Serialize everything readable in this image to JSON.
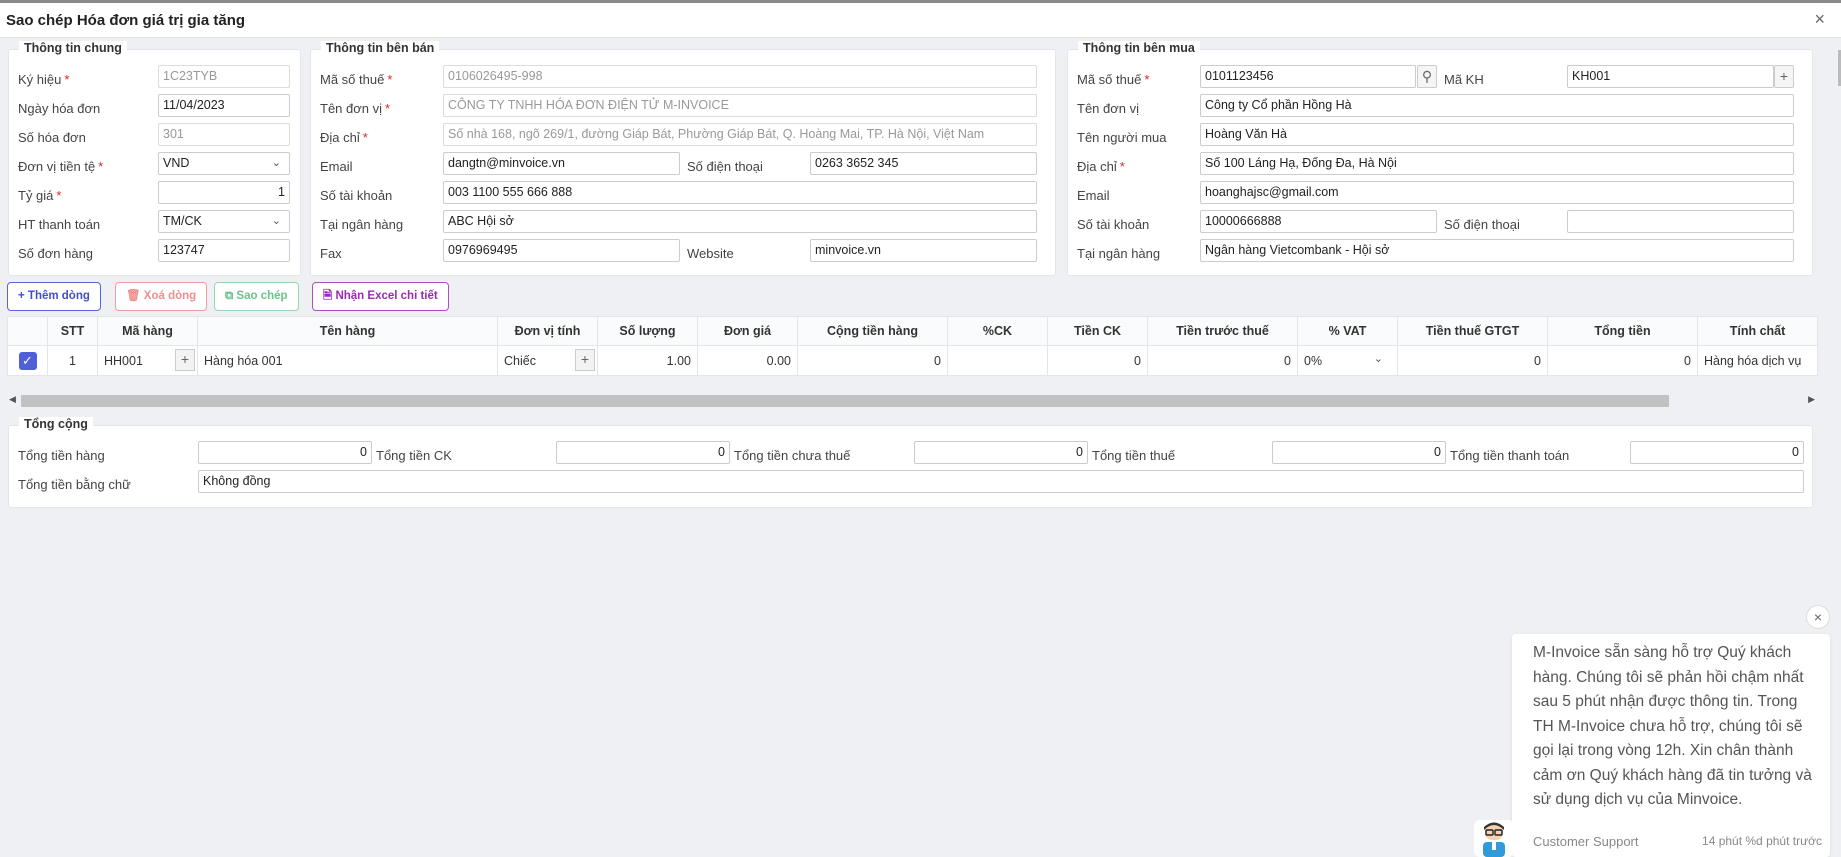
{
  "dialog": {
    "title": "Sao chép Hóa đơn giá trị gia tăng",
    "close": "×"
  },
  "general": {
    "legend": "Thông tin chung",
    "fields": [
      {
        "label": "Ký hiệu",
        "value": "1C23TYB"
      },
      {
        "label": "Ngày hóa đơn",
        "value": "11/04/2023"
      },
      {
        "label": "Số hóa đơn",
        "value": "301"
      },
      {
        "label": "Đơn vị tiền tệ",
        "value": "VND"
      },
      {
        "label": "Tỷ giá",
        "value": "1"
      },
      {
        "label": "HT thanh toán",
        "value": "TM/CK"
      },
      {
        "label": "Số đơn hàng",
        "value": "123747"
      }
    ]
  },
  "seller": {
    "legend": "Thông tin bên bán",
    "tax_code": {
      "label": "Mã số thuế",
      "value": "0106026495-998"
    },
    "name": {
      "label": "Tên đơn vị",
      "value": "CÔNG TY TNHH HÓA ĐƠN ĐIỆN TỬ M-INVOICE"
    },
    "address": {
      "label": "Địa chỉ",
      "value": "Số nhà 168, ngõ 269/1, đường Giáp Bát, Phường Giáp Bát, Q. Hoàng Mai, TP. Hà Nội, Việt Nam"
    },
    "email": {
      "label": "Email",
      "value": "dangtn@minvoice.vn"
    },
    "phone": {
      "label": "Số điện thoại",
      "value": "0263 3652 345"
    },
    "account": {
      "label": "Số tài khoản",
      "value": "003 1100 555 666 888"
    },
    "bank": {
      "label": "Tại ngân hàng",
      "value": "ABC Hội sở"
    },
    "fax": {
      "label": "Fax",
      "value": "0976969495"
    },
    "website": {
      "label": "Website",
      "value": "minvoice.vn"
    }
  },
  "buyer": {
    "legend": "Thông tin bên mua",
    "tax_code": {
      "label": "Mã số thuế",
      "value": "0101123456"
    },
    "customer_code": {
      "label": "Mã KH",
      "value": "KH001"
    },
    "name": {
      "label": "Tên đơn vị",
      "value": "Công ty Cổ phần Hồng Hà"
    },
    "buyer_name": {
      "label": "Tên người mua",
      "value": "Hoàng Văn Hà"
    },
    "address": {
      "label": "Địa chỉ",
      "value": "Số 100 Láng Hạ, Đống Đa, Hà Nội"
    },
    "email": {
      "label": "Email",
      "value": "hoanghajsc@gmail.com"
    },
    "account": {
      "label": "Số tài khoản",
      "value": "10000666888"
    },
    "phone": {
      "label": "Số điện thoại",
      "value": ""
    },
    "bank": {
      "label": "Tại ngân hàng",
      "value": "Ngân hàng Vietcombank - Hội sở"
    }
  },
  "toolbar": {
    "add": "Thêm dòng",
    "delete": "Xoá dòng",
    "copy": "Sao chép",
    "excel": "Nhận Excel chi tiết"
  },
  "table": {
    "columns": [
      "",
      "STT",
      "Mã hàng",
      "Tên hàng",
      "Đơn vị tính",
      "Số lượng",
      "Đơn giá",
      "Cộng tiền hàng",
      "%CK",
      "Tiền CK",
      "Tiền trước thuế",
      "% VAT",
      "Tiền thuế GTGT",
      "Tổng tiền",
      "Tính chất"
    ],
    "rows": [
      {
        "stt": "1",
        "code": "HH001",
        "name": "Hàng hóa 001",
        "unit": "Chiếc",
        "qty": "1.00",
        "price": "0.00",
        "amount": "0",
        "ck_pct": "",
        "ck": "0",
        "pre_tax": "0",
        "vat": "0%",
        "vat_amount": "0",
        "total": "0",
        "nature": "Hàng hóa dịch vụ"
      }
    ]
  },
  "totals": {
    "legend": "Tổng cộng",
    "goods": {
      "label": "Tổng tiền hàng",
      "value": "0"
    },
    "ck": {
      "label": "Tổng tiền CK",
      "value": "0"
    },
    "pre_tax": {
      "label": "Tổng tiền chưa thuế",
      "value": "0"
    },
    "tax": {
      "label": "Tổng tiền thuế",
      "value": "0"
    },
    "payment": {
      "label": "Tổng tiền thanh toán",
      "value": "0"
    },
    "words": {
      "label": "Tổng tiền bằng chữ",
      "value": "Không đồng"
    }
  },
  "support": {
    "message": "M-Invoice sẵn sàng hỗ trợ Quý khách hàng. Chúng tôi sẽ phản hồi chậm nhất sau 5 phút nhận được thông tin. Trong TH M-Invoice chưa hỗ trợ, chúng tôi sẽ gọi lại trong vòng 12h. Xin chân thành cảm ơn Quý khách hàng đã tin tưởng và sử dụng dịch vụ của Minvoice.",
    "agent": "Customer Support",
    "time": "14 phút %d phút trước"
  },
  "colors": {
    "accent": "#4f5fd8",
    "required": "#e02424"
  }
}
